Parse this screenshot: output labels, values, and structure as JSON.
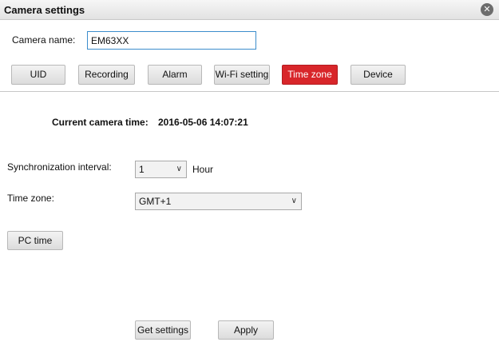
{
  "window": {
    "title": "Camera settings",
    "close_icon": "close-icon"
  },
  "camera_name": {
    "label": "Camera name:",
    "value": "EM63XX"
  },
  "tabs": [
    {
      "label": "UID",
      "active": false
    },
    {
      "label": "Recording",
      "active": false
    },
    {
      "label": "Alarm",
      "active": false
    },
    {
      "label": "Wi-Fi setting",
      "active": false
    },
    {
      "label": "Time zone",
      "active": true
    },
    {
      "label": "Device",
      "active": false
    }
  ],
  "current_time": {
    "label": "Current camera time:",
    "value": "2016-05-06 14:07:21"
  },
  "sync": {
    "label": "Synchronization interval:",
    "value": "1",
    "unit": "Hour"
  },
  "timezone": {
    "label": "Time zone:",
    "value": "GMT+1"
  },
  "buttons": {
    "pc_time": "PC time",
    "get_settings": "Get settings",
    "apply": "Apply"
  },
  "colors": {
    "active_tab": "#d8262a",
    "input_border": "#3c8dcc"
  }
}
